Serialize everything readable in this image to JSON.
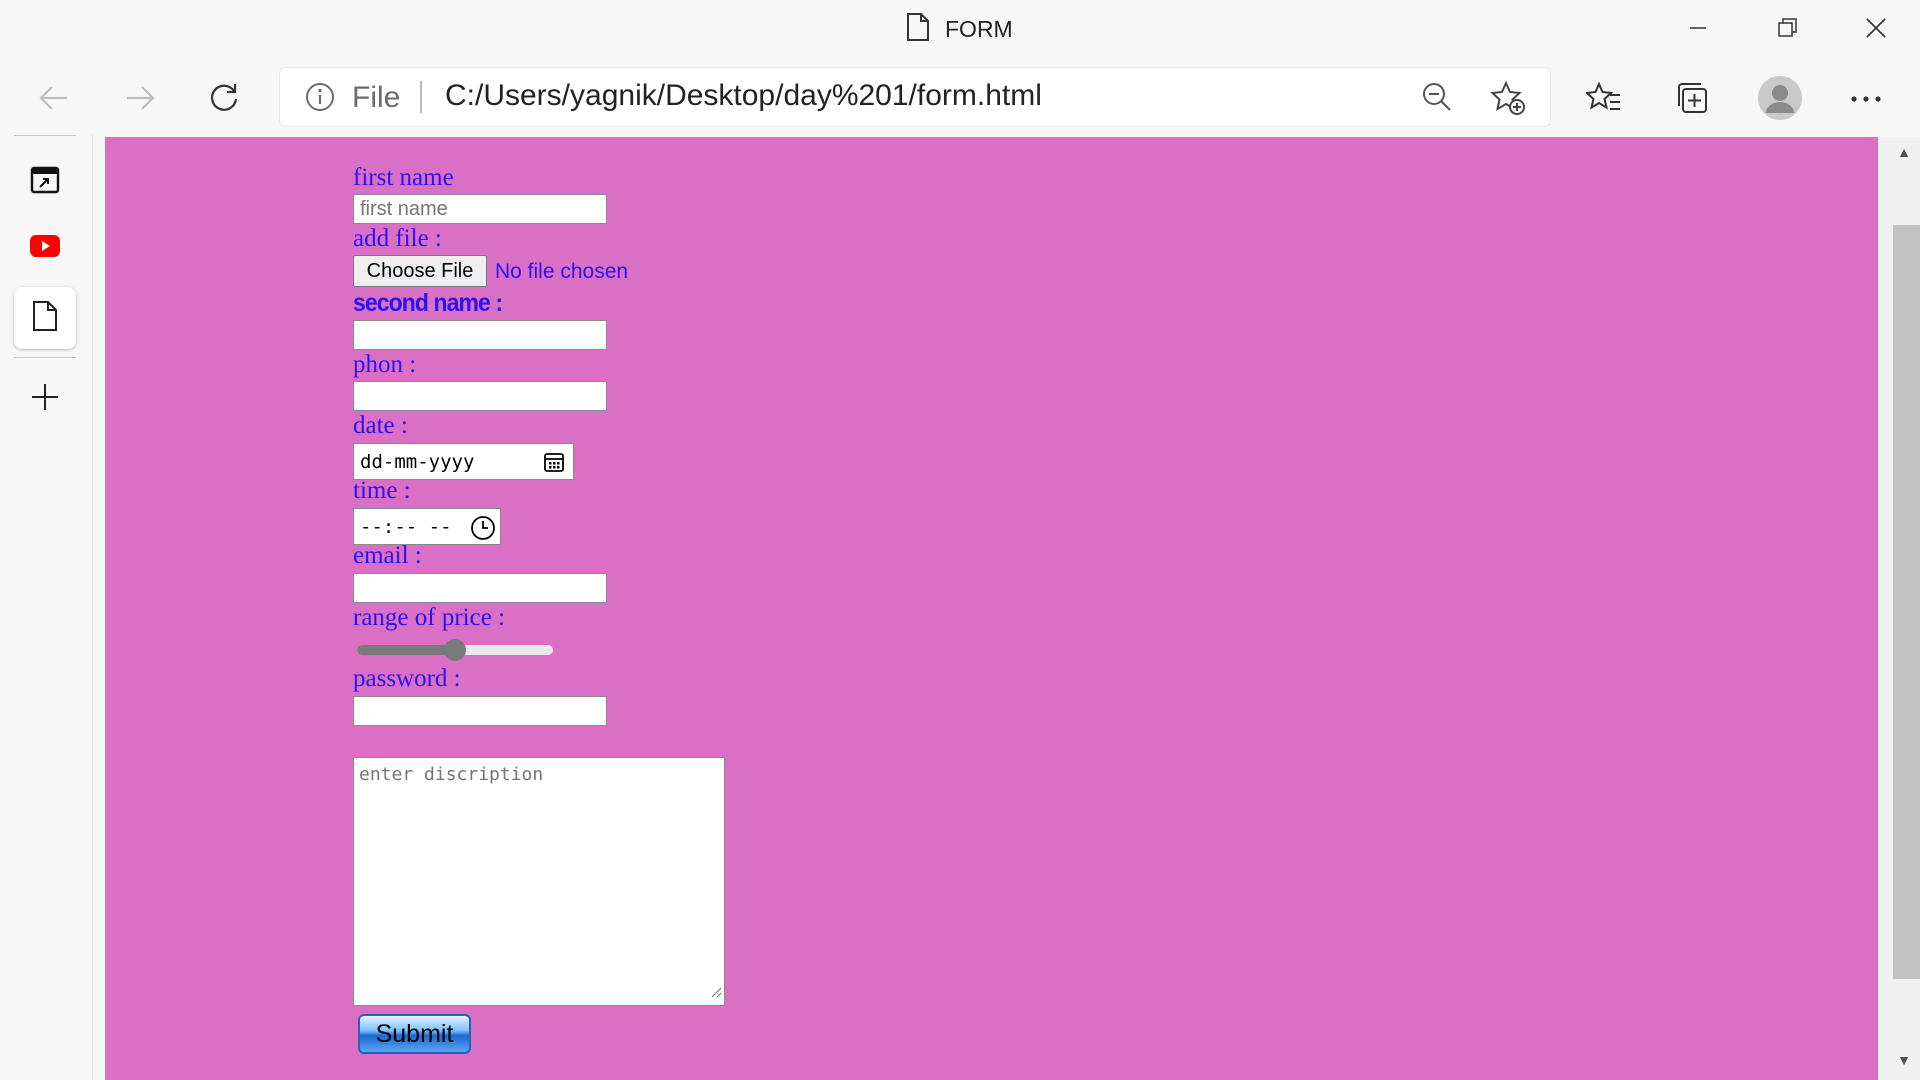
{
  "window": {
    "title": "FORM",
    "minimize_label": "",
    "restore_label": "",
    "close_label": ""
  },
  "address_bar": {
    "scheme_label": "File",
    "url": "C:/Users/yagnik/Desktop/day%201/form.html"
  },
  "icons": {
    "back": "back-arrow-icon",
    "forward": "forward-arrow-icon",
    "refresh": "refresh-icon",
    "info": "info-icon",
    "zoom": "zoom-out-icon",
    "add_favorite": "add-favorite-icon",
    "favorites": "favorites-icon",
    "collections": "collections-icon",
    "profile": "profile-avatar-icon",
    "more": "more-icon"
  },
  "sidebar": {
    "items": [
      "app-icon",
      "youtube-icon",
      "document-icon",
      "add-icon"
    ]
  },
  "page": {
    "background": "#d970c6",
    "label_color": "#2a12f0"
  },
  "form": {
    "first_name_label": "first name",
    "first_name_placeholder": "first name",
    "add_file_label": "add file :",
    "choose_file_button": "Choose File",
    "no_file_text": "No file chosen",
    "second_name_label": "second name :",
    "phone_label": "phon :",
    "date_label": "date :",
    "date_placeholder": "dd-mm-yyyy",
    "time_label": "time :",
    "time_placeholder": "--:-- --",
    "email_label": "email :",
    "range_label": "range of price :",
    "range_value_fraction": 0.5,
    "password_label": "password :",
    "description_placeholder": "enter discription",
    "submit_label": "Submit"
  }
}
